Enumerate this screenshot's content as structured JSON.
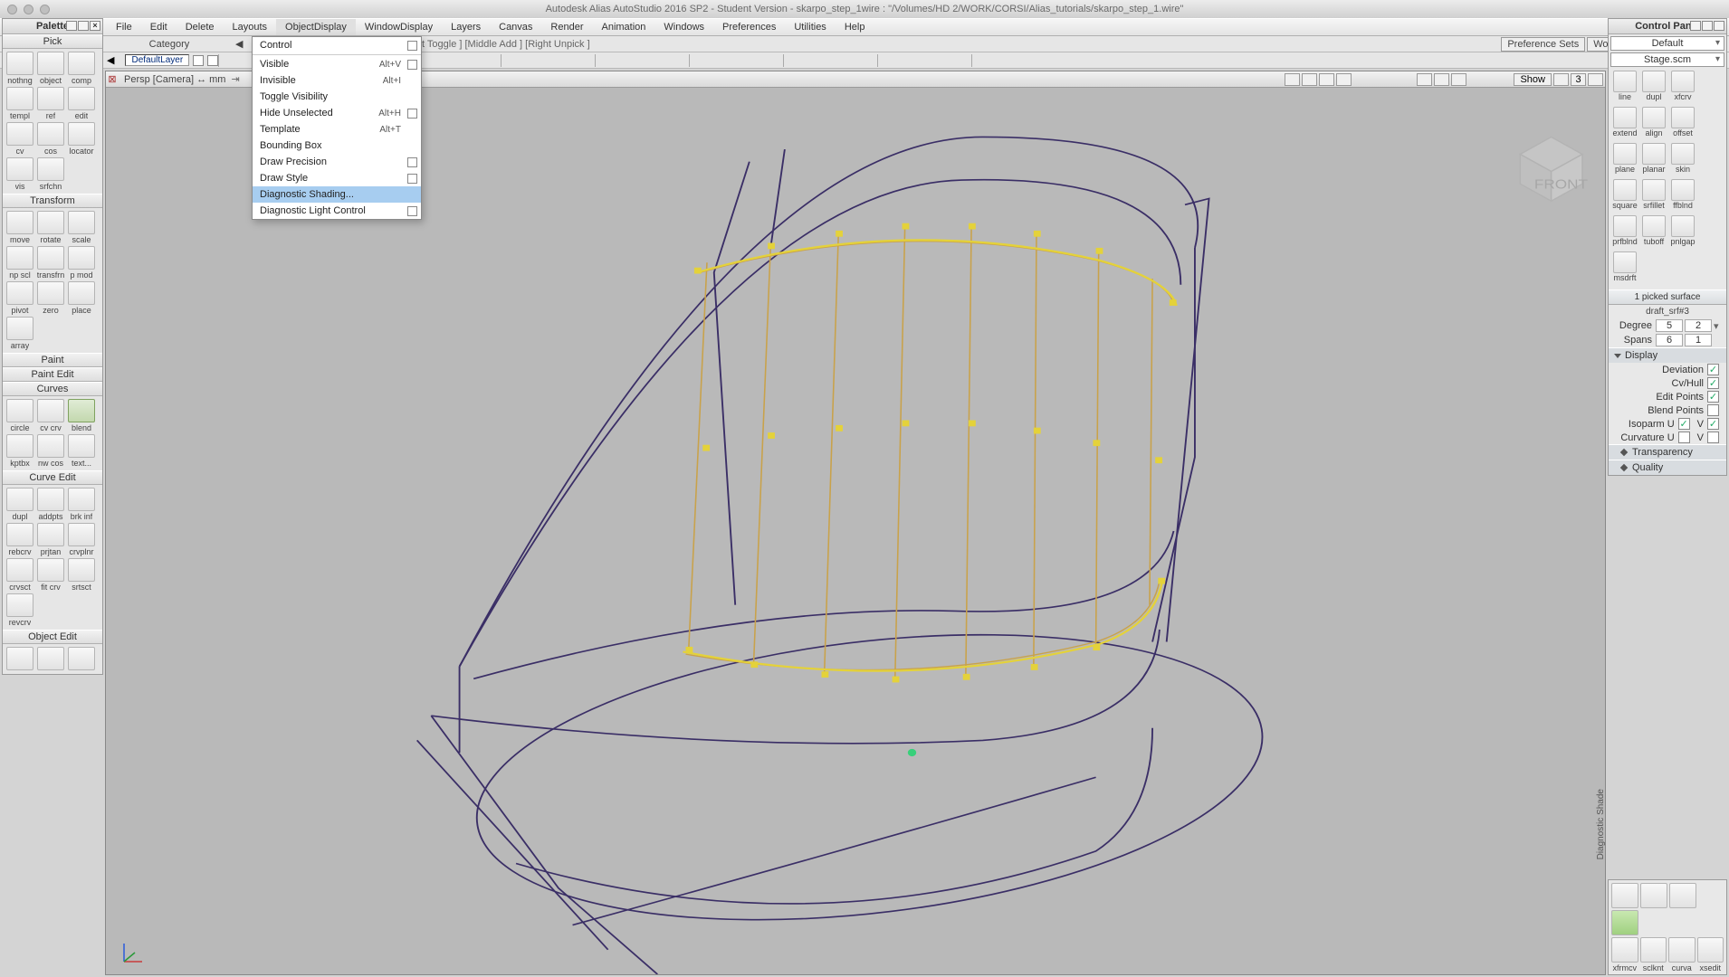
{
  "title": "Autodesk Alias AutoStudio 2016 SP2 - Student Version   - skarpo_step_1wire : \"/Volumes/HD 2/WORK/CORSI/Alias_tutorials/skarpo_step_1.wire\"",
  "menus": [
    "File",
    "Edit",
    "Delete",
    "Layouts",
    "ObjectDisplay",
    "WindowDisplay",
    "Layers",
    "Canvas",
    "Render",
    "Animation",
    "Windows",
    "Preferences",
    "Utilities",
    "Help"
  ],
  "active_menu_index": 4,
  "dropdown": [
    {
      "label": "Control",
      "shortcut": "",
      "opt": true
    },
    {
      "sep": true
    },
    {
      "label": "Visible",
      "shortcut": "Alt+V",
      "opt": true
    },
    {
      "label": "Invisible",
      "shortcut": "Alt+I"
    },
    {
      "label": "Toggle Visibility",
      "shortcut": ""
    },
    {
      "label": "Hide Unselected",
      "shortcut": "Alt+H",
      "opt": true
    },
    {
      "label": "Template",
      "shortcut": "Alt+T"
    },
    {
      "label": "Bounding Box",
      "shortcut": ""
    },
    {
      "label": "Draw Precision",
      "shortcut": "",
      "opt": true
    },
    {
      "label": "Draw Style",
      "shortcut": "",
      "opt": true
    },
    {
      "label": "Diagnostic Shading...",
      "shortcut": "",
      "hl": true
    },
    {
      "label": "Diagnostic Light Control",
      "shortcut": "",
      "opt": true
    }
  ],
  "category_label": "Category",
  "prompt_text": "r name of item to pick /unpick: [Left Toggle ] [Middle Add ] [Right Unpick ]",
  "pref_sets": "Preference Sets",
  "workspaces": "Workspaces",
  "default_layer": "DefaultLayer",
  "palette_title": "Palette",
  "sections": {
    "Pick": [
      [
        "nothng",
        "object",
        "comp"
      ],
      [
        "templ",
        "ref",
        "edit"
      ],
      [
        "cv",
        "cos",
        "locator"
      ],
      [
        "vis",
        "srfchn",
        ""
      ]
    ],
    "Transform": [
      [
        "move",
        "rotate",
        "scale"
      ],
      [
        "np scl",
        "transfrn",
        "p mod"
      ],
      [
        "pivot",
        "zero",
        "place"
      ],
      [
        "array",
        "",
        ""
      ]
    ],
    "Paint": [],
    "Paint Edit": [],
    "Curves": [
      [
        "circle",
        "cv crv",
        "blend"
      ],
      [
        "kptbx",
        "nw cos",
        "text..."
      ]
    ],
    "Curve Edit": [
      [
        "dupl",
        "addpts",
        "brk inf"
      ],
      [
        "rebcrv",
        "prjtan",
        "crvplnr"
      ],
      [
        "crvsct",
        "fit crv",
        "srtsct"
      ],
      [
        "revcrv",
        "",
        ""
      ]
    ],
    "Object Edit": [
      [
        "",
        "",
        ""
      ]
    ]
  },
  "ctrl_title": "Control Panel",
  "ctrl_dd1": "Default",
  "ctrl_dd2": "Stage.scm",
  "right_tools": [
    [
      "line",
      "dupl",
      "xfcrv",
      "extend"
    ],
    [
      "align",
      "offset",
      "plane",
      "planar"
    ],
    [
      "skin",
      "square",
      "srfillet",
      "ffblnd"
    ],
    [
      "prfblnd",
      "tuboff",
      "pnlgap",
      "msdrft"
    ]
  ],
  "picked_text": "1 picked surface",
  "obj_name": "draft_srf#3",
  "degree_label": "Degree",
  "degree_u": "5",
  "degree_v": "2",
  "spans_label": "Spans",
  "spans_u": "6",
  "spans_v": "1",
  "display_label": "Display",
  "disp_rows": [
    {
      "label": "Deviation",
      "chk": true
    },
    {
      "label": "Cv/Hull",
      "chk": true
    },
    {
      "label": "Edit Points",
      "chk": true
    },
    {
      "label": "Blend Points",
      "chk": false
    },
    {
      "label": "Isoparm U",
      "chk": true,
      "label2": "V",
      "chk2": true
    },
    {
      "label": "Curvature U",
      "chk": false,
      "label2": "V",
      "chk2": false
    }
  ],
  "transparency_label": "Transparency",
  "quality_label": "Quality",
  "view_title": "Persp [Camera] ↔ mm",
  "show_btn": "Show",
  "diag_shade_text": "Diagnostic Shade",
  "shelf_labels": [
    "xfrmcv",
    "sclknt",
    "curva",
    "xsedit"
  ]
}
